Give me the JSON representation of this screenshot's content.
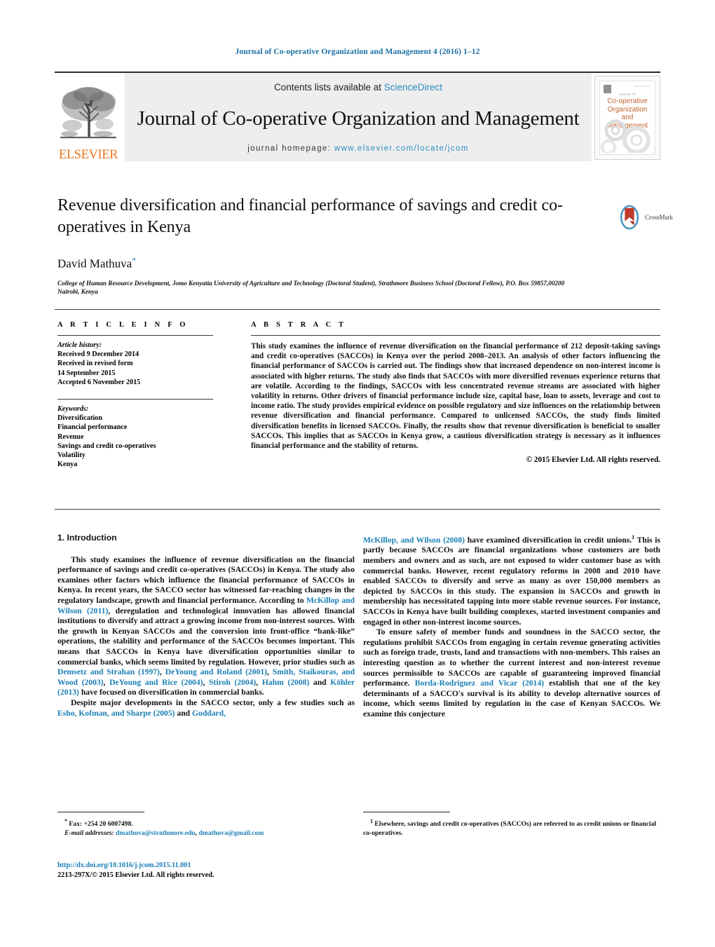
{
  "running_head": "Journal of Co-operative Organization and Management 4 (2016) 1–12",
  "masthead": {
    "contents_prefix": "Contents lists available at ",
    "sciencedirect": "ScienceDirect",
    "journal_title": "Journal of Co-operative Organization and Management",
    "homepage_prefix": "journal homepage: ",
    "homepage_url": "www.elsevier.com/locate/jcom",
    "elsevier_wordmark": "ELSEVIER",
    "cover": {
      "issn": "ISSN 2213-297X",
      "journal_word": "Journal of",
      "title": "Co-operative Organization and Management"
    }
  },
  "article": {
    "title": "Revenue diversification and financial performance of savings and credit co-operatives in Kenya",
    "author": "David Mathuva",
    "author_marker": "*",
    "affiliation": "College of Human Resource Development, Jomo Kenyatta University of Agriculture and Technology (Doctoral Student), Strathmore Business School (Doctoral Fellow), P.O. Box 59857,00200 Nairobi, Kenya",
    "crossmark_label": "CrossMark"
  },
  "info": {
    "heading": "A R T I C L E   I N F O",
    "history_label": "Article history:",
    "history": [
      "Received 9 December 2014",
      "Received in revised form",
      "14 September 2015",
      "Accepted 6 November 2015"
    ],
    "keywords_label": "Keywords:",
    "keywords": [
      "Diversification",
      "Financial performance",
      "Revenue",
      "Savings and credit co-operatives",
      "Volatility",
      "Kenya"
    ]
  },
  "abstract": {
    "heading": "A B S T R A C T",
    "text": "This study examines the influence of revenue diversification on the financial performance of 212 deposit-taking savings and credit co-operatives (SACCOs) in Kenya over the period 2008–2013. An analysis of other factors influencing the financial performance of SACCOs is carried out. The findings show that increased dependence on non-interest income is associated with higher returns. The study also finds that SACCOs with more diversified revenues experience returns that are volatile. According to the findings, SACCOs with less concentrated revenue streams are associated with higher volatility in returns. Other drivers of financial performance include size, capital base, loan to assets, leverage and cost to income ratio. The study provides empirical evidence on possible regulatory and size influences on the relationship between revenue diversification and financial performance. Compared to unlicensed SACCOs, the study finds limited diversification benefits in licensed SACCOs. Finally, the results show that revenue diversification is beneficial to smaller SACCOs. This implies that as SACCOs in Kenya grow, a cautious diversification strategy is necessary as it influences financial performance and the stability of returns.",
    "copyright": "© 2015 Elsevier Ltd. All rights reserved."
  },
  "introduction": {
    "heading": "1.  Introduction",
    "left": {
      "p1_a": "This study examines the influence of revenue diversification on the financial performance of savings and credit co-operatives (SACCOs) in Kenya. The study also examines other factors which influence the financial performance of SACCOs in Kenya. In recent years, the SACCO sector has witnessed far-reaching changes in the regulatory landscape, growth and financial performance. According to ",
      "ref1": "McKillop and Wilson (2011)",
      "p1_b": ", deregulation and technological innovation has allowed financial institutions to diversify and attract a growing income from non-interest sources. With the growth in Kenyan SACCOs and the conversion into front-office “bank-like” operations, the stability and performance of the SACCOs becomes important. This means that SACCOs in Kenya have diversification opportunities similar to commercial banks, which seems limited by regulation. However, prior studies such as ",
      "ref2": "Demsetz and Strahan (1997)",
      "sep1": ", ",
      "ref3": "DeYoung and Roland (2001)",
      "sep2": ", ",
      "ref4": "Smith, Staikouras, and Wood (2003)",
      "sep3": ", ",
      "ref5": "DeYoung and Rice (2004)",
      "sep4": ", ",
      "ref6": "Stiroh (2004)",
      "sep5": ", ",
      "ref7": "Hahm (2008)",
      "sep6": " and ",
      "ref8": "Köhler (2013)",
      "p1_c": " have focused on diversification in commercial banks.",
      "p2_a": "Despite major developments in the SACCO sector, only a few studies such as ",
      "ref9": "Esho, Kofman, and Sharpe (2005)",
      "p2_b": " and ",
      "ref10": "Goddard,"
    },
    "right": {
      "ref11": "McKillop, and Wilson (2008)",
      "p1_a": " have examined diversification in credit unions.",
      "footnote_marker": "1",
      "p1_b": " This is partly because SACCOs are financial organizations whose customers are both members and owners and as such, are not exposed to wider customer base as with commercial banks. However, recent regulatory reforms in 2008 and 2010 have enabled SACCOs to diversify and serve as many as over 150,000 members as depicted by SACCOs in this study. The expansion in SACCOs and growth in membership has necessitated tapping into more stable revenue sources. For instance, SACCOs in Kenya have built building complexes, started investment companies and engaged in other non-interest income sources.",
      "p2_a": "To ensure safety of member funds and soundness in the SACCO sector, the regulations prohibit SACCOs from engaging in certain revenue generating activities such as foreign trade, trusts, land and transactions with non-members. This raises an interesting question as to whether the current interest and non-interest revenue sources permissible to SACCOs are capable of guaranteeing improved financial performance. ",
      "ref12": "Borda-Rodriguez and Vicar (2014)",
      "p2_b": " establish that one of the key determinants of a SACCO's survival is its ability to develop alternative sources of income, which seems limited by regulation in the case of Kenyan SACCOs. We examine this conjecture"
    }
  },
  "footnotes": {
    "left_marker": "*",
    "fax": "Fax: +254 20 6007498.",
    "email_label": "E-mail addresses:",
    "email1": "dmathuva@strathmore.edu",
    "email_sep": ", ",
    "email2": "dmathuva@gmail.com",
    "right_marker": "1",
    "right_text": "Elsewhere, savings and credit co-operatives (SACCOs) are referred to as credit unions or financial co-operatives."
  },
  "publication": {
    "doi": "http://dx.doi.org/10.1016/j.jcom.2015.11.001",
    "issn_line": "2213-297X/© 2015 Elsevier Ltd. All rights reserved."
  },
  "colors": {
    "link": "#1a7fb5",
    "accent_orange": "#e87722",
    "masthead_bg": "#eeeeee",
    "cover_title": "#c2622c"
  }
}
